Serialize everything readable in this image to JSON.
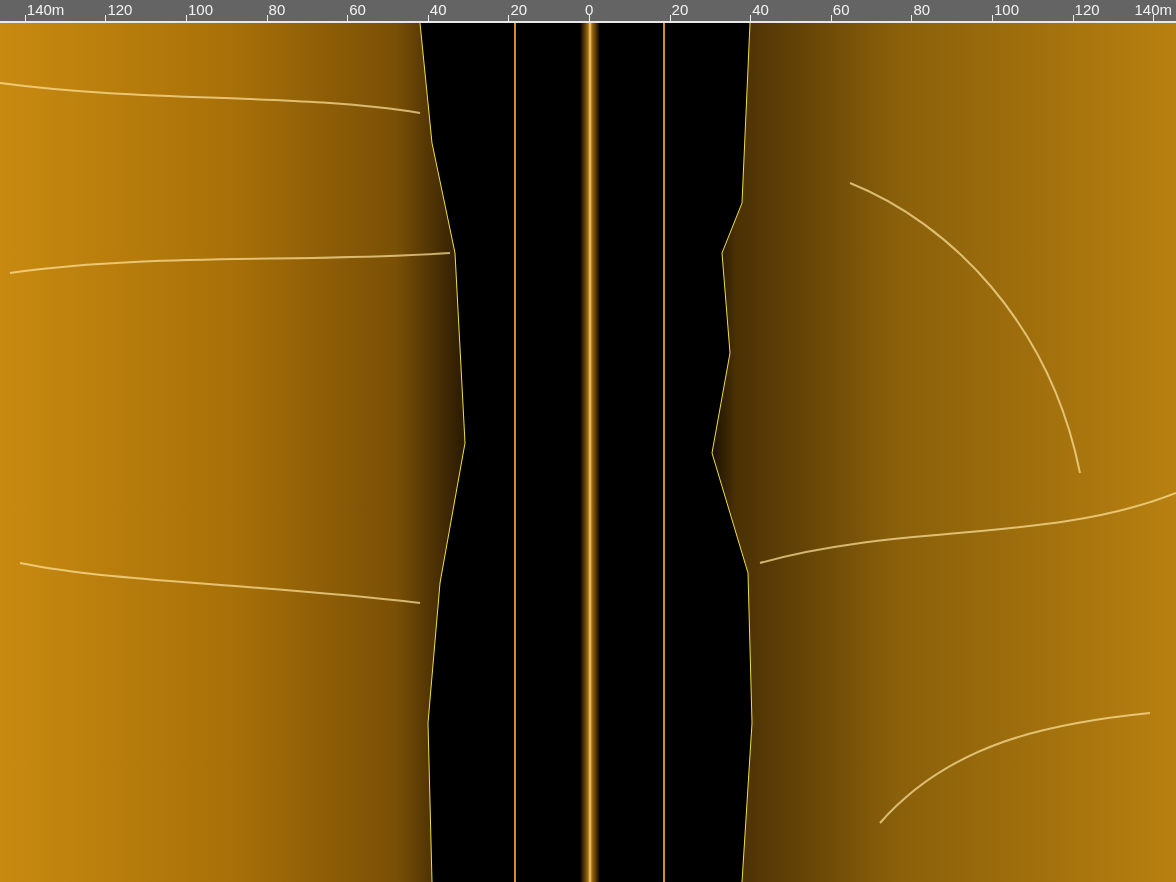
{
  "ruler": {
    "ticks": [
      {
        "label": "140m"
      },
      {
        "label": "120"
      },
      {
        "label": "100"
      },
      {
        "label": "80"
      },
      {
        "label": "60"
      },
      {
        "label": "40"
      },
      {
        "label": "20"
      },
      {
        "label": "0"
      },
      {
        "label": "20"
      },
      {
        "label": "40"
      },
      {
        "label": "60"
      },
      {
        "label": "80"
      },
      {
        "label": "100"
      },
      {
        "label": "120"
      },
      {
        "label": "140m"
      }
    ]
  }
}
